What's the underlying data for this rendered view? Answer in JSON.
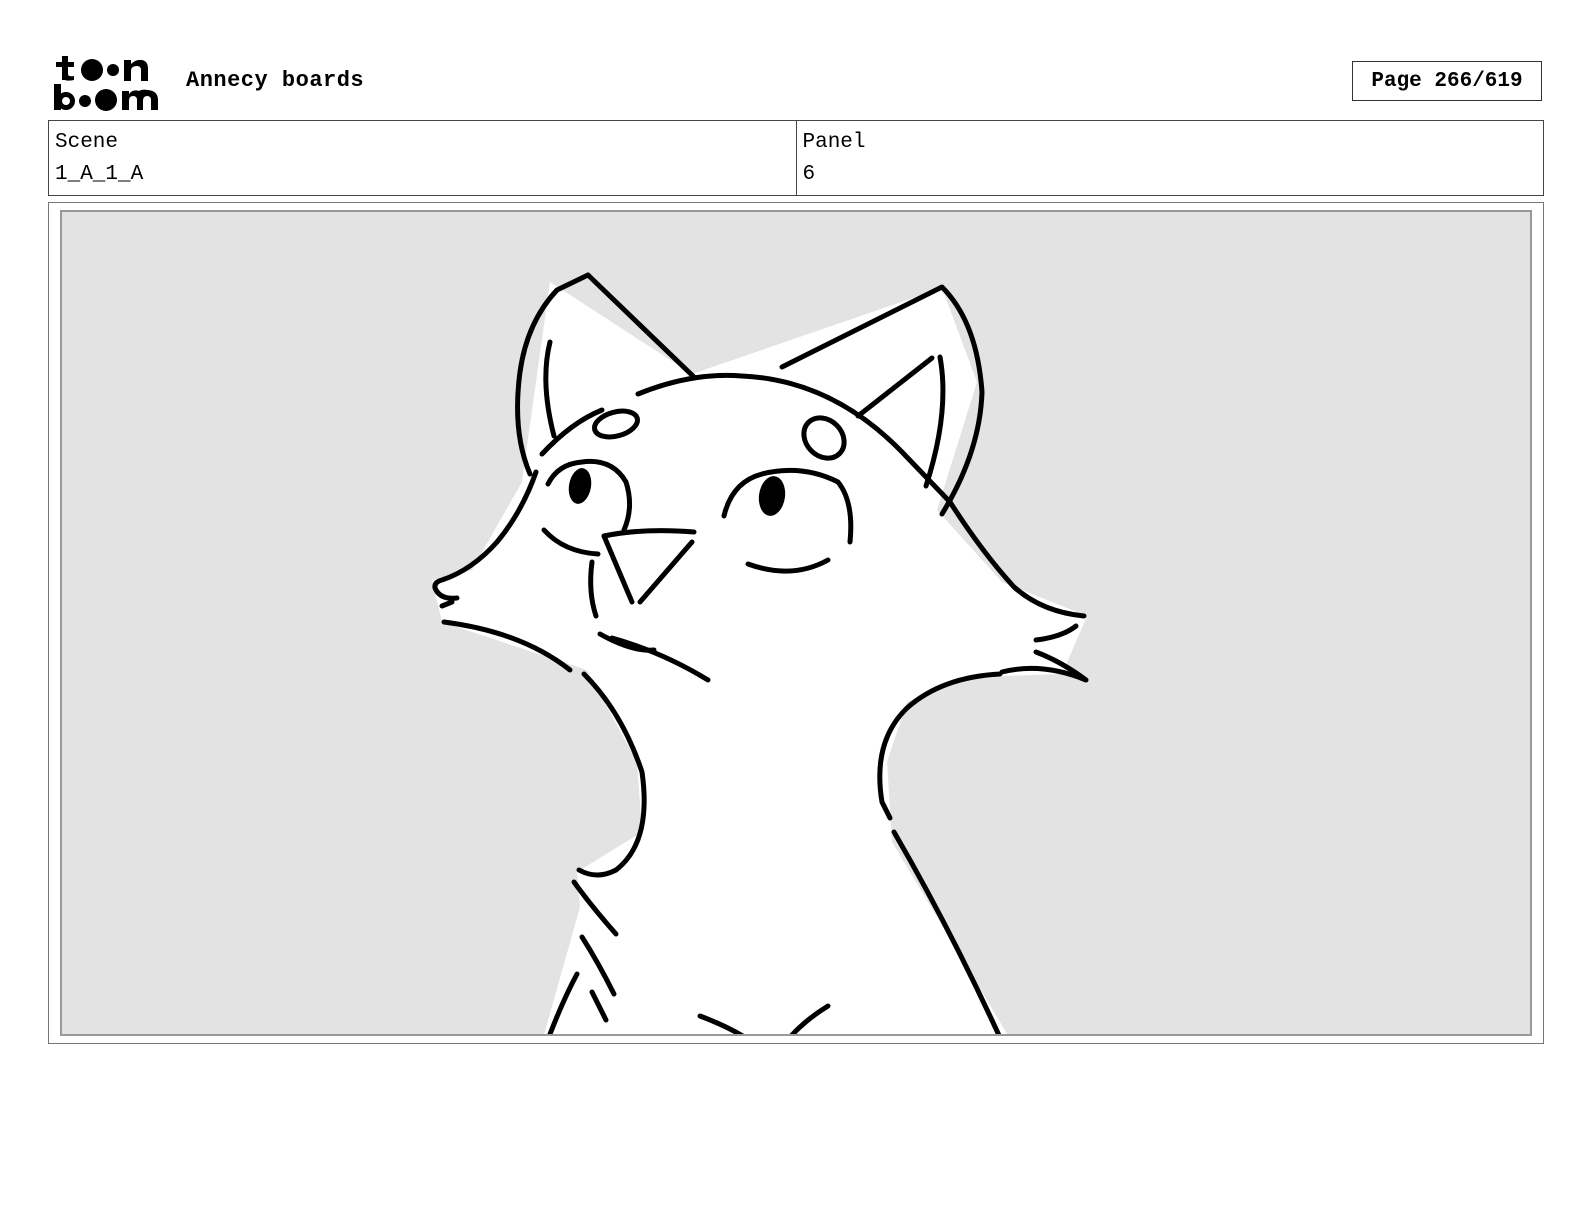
{
  "header": {
    "logo_text": "toon boom",
    "project_title": "Annecy boards",
    "page_counter": "Page 266/619"
  },
  "info": {
    "scene_label": "Scene",
    "scene_value": "1_A_1_A",
    "panel_label": "Panel",
    "panel_value": "6"
  },
  "panel_image": {
    "subject": "fox-character",
    "background_color": "#e3e3e3",
    "line_color": "#000000"
  }
}
